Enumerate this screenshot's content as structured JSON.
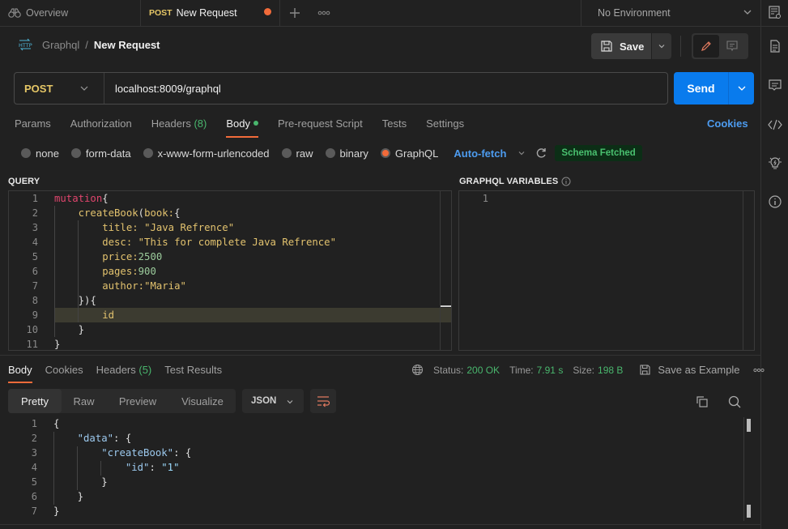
{
  "tabs": {
    "overview_label": "Overview",
    "active_method": "POST",
    "active_label": "New Request",
    "unsaved_dot_color": "#f26b3a"
  },
  "environment": {
    "selected": "No Environment"
  },
  "breadcrumb": {
    "parent": "Graphql",
    "separator": "/",
    "current": "New Request"
  },
  "toolbar": {
    "save_label": "Save"
  },
  "request": {
    "method": "POST",
    "url": "localhost:8009/graphql",
    "send_label": "Send"
  },
  "request_tabs": [
    {
      "label": "Params"
    },
    {
      "label": "Authorization"
    },
    {
      "label": "Headers",
      "count": "(8)"
    },
    {
      "label": "Body",
      "active": true
    },
    {
      "label": "Pre-request Script"
    },
    {
      "label": "Tests"
    },
    {
      "label": "Settings"
    }
  ],
  "cookies_label": "Cookies",
  "body_types": [
    {
      "label": "none"
    },
    {
      "label": "form-data"
    },
    {
      "label": "x-www-form-urlencoded"
    },
    {
      "label": "raw"
    },
    {
      "label": "binary"
    },
    {
      "label": "GraphQL",
      "selected": true
    }
  ],
  "graphql": {
    "autofetch_label": "Auto-fetch",
    "schema_status": "Schema Fetched",
    "query_label": "QUERY",
    "variables_label": "GRAPHQL VARIABLES",
    "query_lines": [
      "mutation{",
      "    createBook(book:{",
      "        title: \"Java Refrence\"",
      "        desc: \"This for complete Java Refrence\"",
      "        price:2500",
      "        pages:900",
      "        author:\"Maria\"",
      "    }){",
      "        id",
      "    }",
      "}"
    ],
    "variables_lines": [
      ""
    ]
  },
  "response": {
    "tabs": [
      {
        "label": "Body",
        "active": true
      },
      {
        "label": "Cookies"
      },
      {
        "label": "Headers",
        "count": "(5)"
      },
      {
        "label": "Test Results"
      }
    ],
    "status_label": "Status:",
    "status_value": "200 OK",
    "time_label": "Time:",
    "time_value": "7.91 s",
    "size_label": "Size:",
    "size_value": "198 B",
    "save_example_label": "Save as Example",
    "views": [
      "Pretty",
      "Raw",
      "Preview",
      "Visualize"
    ],
    "active_view": "Pretty",
    "format": "JSON",
    "body_lines": [
      "{",
      "    \"data\": {",
      "        \"createBook\": {",
      "            \"id\": \"1\"",
      "        }",
      "    }",
      "}"
    ]
  },
  "colors": {
    "accent_orange": "#f26b3a",
    "send_blue": "#097bed",
    "link_blue": "#4d9cf0",
    "success_green": "#49b66d",
    "method_yellow": "#e6c766"
  }
}
